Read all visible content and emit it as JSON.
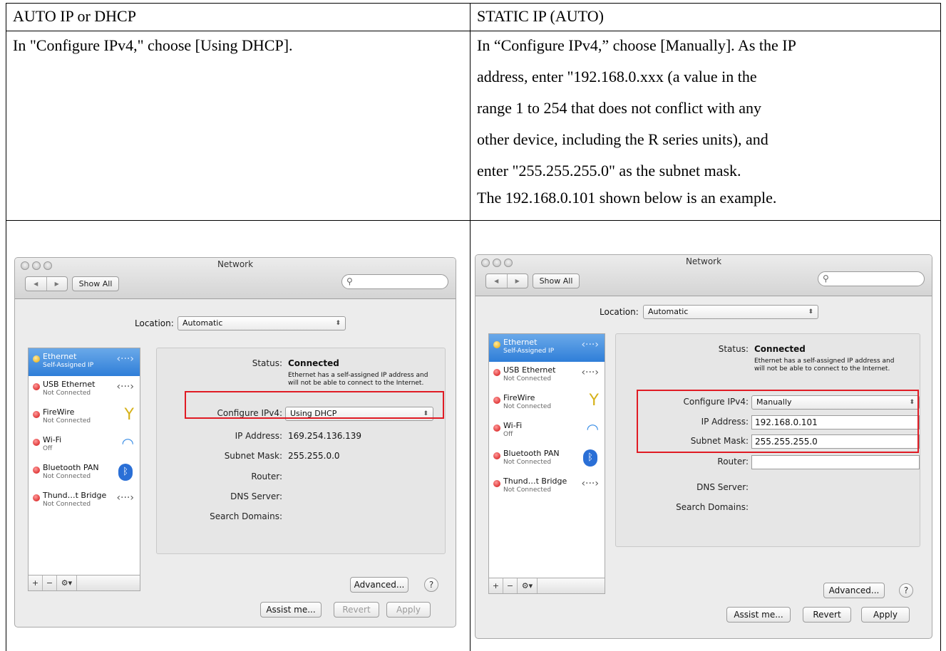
{
  "table": {
    "headers": [
      "AUTO IP or DHCP",
      "STATIC IP (AUTO)"
    ],
    "left_text": [
      "In \"Configure IPv4,\" choose [Using DHCP]."
    ],
    "right_text": [
      "In “Configure IPv4,” choose [Manually]. As the IP",
      "address, enter \"192.168.0.xxx (a value in the",
      "range 1 to 254 that does not conflict with any",
      "other device, including the R series units), and",
      "enter \"255.255.255.0\" as the subnet mask.",
      "The 192.168.0.101 shown below is an example."
    ]
  },
  "windows": [
    {
      "title": "Network",
      "show_all": "Show All",
      "location_label": "Location:",
      "location_value": "Automatic",
      "services": [
        {
          "name": "Ethernet",
          "status": "Self-Assigned IP",
          "dot": "yellow",
          "icon": "ethernet-icon",
          "selected": true
        },
        {
          "name": "USB Ethernet",
          "status": "Not Connected",
          "dot": "red",
          "icon": "ethernet-icon",
          "selected": false
        },
        {
          "name": "FireWire",
          "status": "Not Connected",
          "dot": "red",
          "icon": "firewire-icon",
          "selected": false
        },
        {
          "name": "Wi-Fi",
          "status": "Off",
          "dot": "red",
          "icon": "wifi-icon",
          "selected": false
        },
        {
          "name": "Bluetooth PAN",
          "status": "Not Connected",
          "dot": "red",
          "icon": "bluetooth-icon",
          "selected": false
        },
        {
          "name": "Thund…t Bridge",
          "status": "Not Connected",
          "dot": "red",
          "icon": "ethernet-icon",
          "selected": false
        }
      ],
      "status_label": "Status:",
      "status_value": "Connected",
      "status_note_1": "Ethernet has a self-assigned IP address and",
      "status_note_2": "will not be able to connect to the Internet.",
      "configure_label": "Configure IPv4:",
      "configure_value": "Using DHCP",
      "ip_label": "IP Address:",
      "ip_value": "169.254.136.139",
      "subnet_label": "Subnet Mask:",
      "subnet_value": "255.255.0.0",
      "router_label": "Router:",
      "router_value": "",
      "dns_label": "DNS Server:",
      "search_domains_label": "Search Domains:",
      "advanced_label": "Advanced...",
      "help_label": "?",
      "assist_label": "Assist me...",
      "revert_label": "Revert",
      "apply_label": "Apply"
    },
    {
      "title": "Network",
      "show_all": "Show All",
      "location_label": "Location:",
      "location_value": "Automatic",
      "services": [
        {
          "name": "Ethernet",
          "status": "Self-Assigned IP",
          "dot": "yellow",
          "icon": "ethernet-icon",
          "selected": true
        },
        {
          "name": "USB Ethernet",
          "status": "Not Connected",
          "dot": "red",
          "icon": "ethernet-icon",
          "selected": false
        },
        {
          "name": "FireWire",
          "status": "Not Connected",
          "dot": "red",
          "icon": "firewire-icon",
          "selected": false
        },
        {
          "name": "Wi-Fi",
          "status": "Off",
          "dot": "red",
          "icon": "wifi-icon",
          "selected": false
        },
        {
          "name": "Bluetooth PAN",
          "status": "Not Connected",
          "dot": "red",
          "icon": "bluetooth-icon",
          "selected": false
        },
        {
          "name": "Thund…t Bridge",
          "status": "Not Connected",
          "dot": "red",
          "icon": "ethernet-icon",
          "selected": false
        }
      ],
      "status_label": "Status:",
      "status_value": "Connected",
      "status_note_1": "Ethernet has a self-assigned IP address and",
      "status_note_2": "will not be able to connect to the Internet.",
      "configure_label": "Configure IPv4:",
      "configure_value": "Manually",
      "ip_label": "IP Address:",
      "ip_value": "192.168.0.101",
      "subnet_label": "Subnet Mask:",
      "subnet_value": "255.255.255.0",
      "router_label": "Router:",
      "router_value": "",
      "dns_label": "DNS Server:",
      "search_domains_label": "Search Domains:",
      "advanced_label": "Advanced...",
      "help_label": "?",
      "assist_label": "Assist me...",
      "revert_label": "Revert",
      "apply_label": "Apply"
    }
  ],
  "colors": {
    "highlight_box": "#e01b24",
    "selected_row": "#2f7ed8"
  }
}
